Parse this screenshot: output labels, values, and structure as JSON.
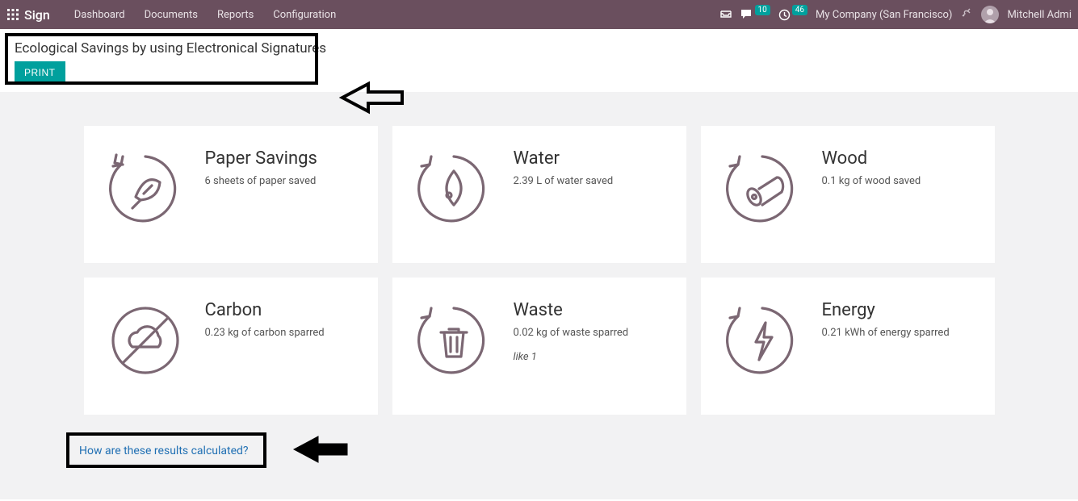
{
  "nav": {
    "brand": "Sign",
    "links": [
      "Dashboard",
      "Documents",
      "Reports",
      "Configuration"
    ],
    "chat_count": "10",
    "activity_count": "46",
    "company": "My Company (San Francisco)",
    "username": "Mitchell Admi"
  },
  "header": {
    "title": "Ecological Savings by using Electronical Signatures",
    "print_label": "PRINT"
  },
  "cards": [
    {
      "title": "Paper Savings",
      "desc": "6 sheets of paper saved",
      "icon": "leaf-cycle-icon"
    },
    {
      "title": "Water",
      "desc": "2.39 L of water saved",
      "icon": "water-cycle-icon"
    },
    {
      "title": "Wood",
      "desc": "0.1 kg of wood saved",
      "icon": "wood-cycle-icon"
    },
    {
      "title": "Carbon",
      "desc": "0.23 kg of carbon sparred",
      "icon": "carbon-icon"
    },
    {
      "title": "Waste",
      "desc": "0.02 kg of waste sparred",
      "extra": "like 1",
      "icon": "waste-cycle-icon"
    },
    {
      "title": "Energy",
      "desc": "0.21 kWh of energy sparred",
      "icon": "energy-cycle-icon"
    }
  ],
  "footer": {
    "link_label": "How are these results calculated?"
  }
}
